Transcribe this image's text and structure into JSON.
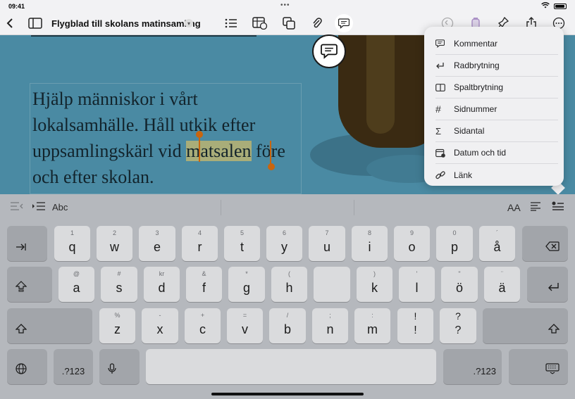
{
  "status": {
    "time": "09:41",
    "battery": "100%"
  },
  "toolbar": {
    "title": "Flygblad till skolans matinsamling",
    "icons": [
      "back-icon",
      "sidebar-icon",
      "list-icon",
      "table-icon",
      "shapes-icon",
      "attachment-icon",
      "comment-icon",
      "undo-icon",
      "paint-icon",
      "pin-icon",
      "share-icon",
      "more-icon"
    ]
  },
  "document": {
    "text_before": "Hjälp människor i vårt lokalsamhälle. Håll utkik efter uppsamlingskärl vid ",
    "text_selected": "matsalen",
    "text_after": " före och efter skolan."
  },
  "menu": {
    "items": [
      {
        "icon": "comment-icon",
        "label": "Kommentar"
      },
      {
        "icon": "line-break-icon",
        "label": "Radbrytning"
      },
      {
        "icon": "column-break-icon",
        "label": "Spaltbrytning"
      },
      {
        "icon": "hash-icon",
        "label": "Sidnummer"
      },
      {
        "icon": "sigma-icon",
        "label": "Sidantal"
      },
      {
        "icon": "calendar-icon",
        "label": "Datum och tid"
      },
      {
        "icon": "link-icon",
        "label": "Länk"
      }
    ]
  },
  "shortcut_bar": {
    "abc_label": "Abc",
    "font_size_label": "AA"
  },
  "keyboard": {
    "row1": [
      {
        "sub": "1",
        "main": "q"
      },
      {
        "sub": "2",
        "main": "w"
      },
      {
        "sub": "3",
        "main": "e"
      },
      {
        "sub": "4",
        "main": "r"
      },
      {
        "sub": "5",
        "main": "t"
      },
      {
        "sub": "6",
        "main": "y"
      },
      {
        "sub": "7",
        "main": "u"
      },
      {
        "sub": "8",
        "main": "i"
      },
      {
        "sub": "9",
        "main": "o"
      },
      {
        "sub": "0",
        "main": "p"
      },
      {
        "sub": "´",
        "main": "å"
      }
    ],
    "row2": [
      {
        "sub": "@",
        "main": "a"
      },
      {
        "sub": "#",
        "main": "s"
      },
      {
        "sub": "kr",
        "main": "d"
      },
      {
        "sub": "&",
        "main": "f"
      },
      {
        "sub": "*",
        "main": "g"
      },
      {
        "sub": "(",
        "main": "h"
      },
      {
        "sub": ")",
        "main": "k"
      },
      {
        "sub": "'",
        "main": "l"
      },
      {
        "sub": "\"",
        "main": "ö"
      },
      {
        "sub": "¨",
        "main": "ä"
      }
    ],
    "row3": [
      {
        "sub": "%",
        "main": "z"
      },
      {
        "sub": "-",
        "main": "x"
      },
      {
        "sub": "+",
        "main": "c"
      },
      {
        "sub": "=",
        "main": "v"
      },
      {
        "sub": "/",
        "main": "b"
      },
      {
        "sub": ";",
        "main": "n"
      },
      {
        "sub": ":",
        "main": "m"
      },
      {
        "sub": "",
        "main": "!"
      },
      {
        "sub": "",
        "main": "?"
      }
    ],
    "numbers_label": ".?123"
  }
}
